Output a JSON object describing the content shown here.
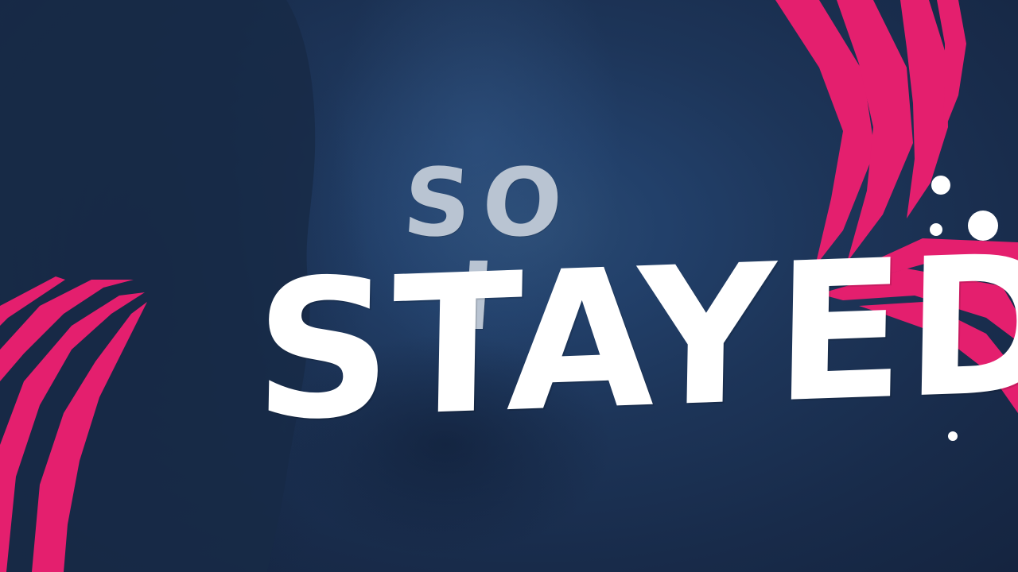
{
  "lyrics": {
    "line1": "SO I",
    "line2": "STAYED"
  },
  "colors": {
    "background": "#1b2e4d",
    "accent": "#e41f6e",
    "text_primary": "#ffffff",
    "text_secondary": "#b9c4d2"
  }
}
